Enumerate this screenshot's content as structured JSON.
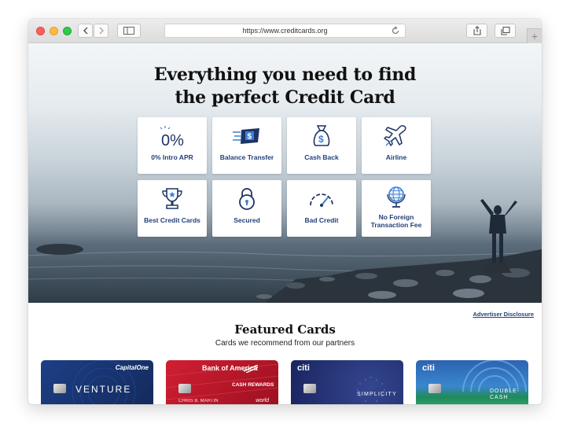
{
  "browser": {
    "url": "https://www.creditcards.org",
    "new_tab": "+"
  },
  "hero": {
    "headline_line1": "Everything you need to find",
    "headline_line2": "the perfect Credit Card",
    "intro_apr_glyph": "0%"
  },
  "categories": [
    {
      "label": "0% Intro APR",
      "icon": "percent-icon"
    },
    {
      "label": "Balance Transfer",
      "icon": "balance-transfer-icon"
    },
    {
      "label": "Cash Back",
      "icon": "money-bag-icon"
    },
    {
      "label": "Airline",
      "icon": "airplane-icon"
    },
    {
      "label": "Best Credit Cards",
      "icon": "trophy-icon"
    },
    {
      "label": "Secured",
      "icon": "padlock-icon"
    },
    {
      "label": "Bad Credit",
      "icon": "gauge-icon"
    },
    {
      "label": "No Foreign",
      "label_line2": "Transaction Fee",
      "icon": "globe-icon"
    }
  ],
  "advertiser_disclosure": "Advertiser Disclosure",
  "featured": {
    "title": "Featured Cards",
    "subtitle": "Cards we recommend from our partners"
  },
  "cards": [
    {
      "issuer": "CapitalOne",
      "name": "VENTURE",
      "color": "#1b3a7a"
    },
    {
      "issuer": "Bank of America",
      "name": "CASH REWARDS",
      "holder": "CHRIS B. MARTIN",
      "network": "world",
      "color": "#c0182a"
    },
    {
      "issuer": "citi",
      "name": "SIMPLICITY",
      "color": "#23347a"
    },
    {
      "issuer": "citi",
      "name": "DOUBLE CASH",
      "color": "#2c6fb4"
    }
  ],
  "colors": {
    "label_blue": "#24407a",
    "icon_navy": "#1e3466",
    "icon_blue": "#3f7fd0"
  }
}
